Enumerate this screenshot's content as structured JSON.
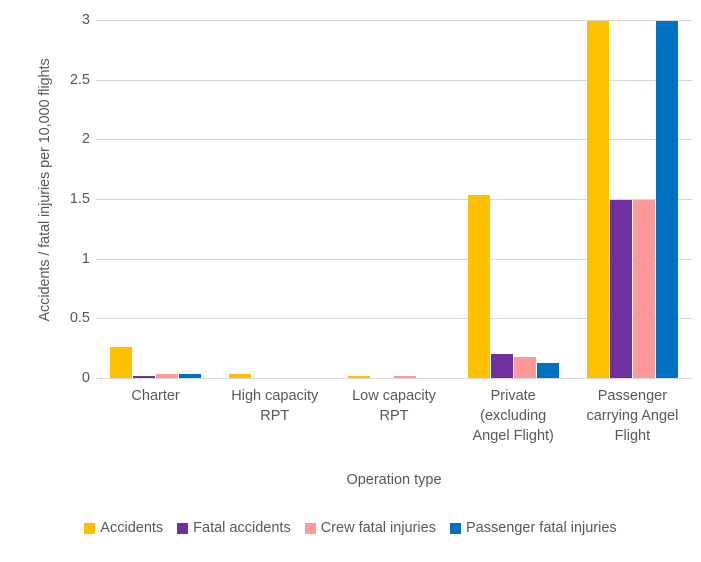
{
  "chart_data": {
    "type": "bar",
    "title": "",
    "xlabel": "Operation type",
    "ylabel": "Accidents / fatal injuries per 10,000 flights",
    "ylim": [
      0,
      3
    ],
    "yticks": [
      0,
      0.5,
      1,
      1.5,
      2,
      2.5,
      3
    ],
    "ytick_labels": [
      "0",
      "0.5",
      "1",
      "1.5",
      "2",
      "2.5",
      "3"
    ],
    "grid": true,
    "legend_position": "bottom",
    "categories": [
      "Charter",
      "High capacity RPT",
      "Low capacity RPT",
      "Private (excluding Angel Flight)",
      "Passenger carrying Angel Flight"
    ],
    "category_label_lines": [
      [
        "Charter"
      ],
      [
        "High capacity",
        "RPT"
      ],
      [
        "Low capacity",
        "RPT"
      ],
      [
        "Private",
        "(excluding",
        "Angel Flight)"
      ],
      [
        "Passenger",
        "carrying Angel",
        "Flight"
      ]
    ],
    "series": [
      {
        "name": "Accidents",
        "color": "#FFC000",
        "values": [
          0.26,
          0.03,
          0.02,
          1.53,
          2.99
        ]
      },
      {
        "name": "Fatal accidents",
        "color": "#7030A0",
        "values": [
          0.02,
          0,
          0,
          0.2,
          1.49
        ]
      },
      {
        "name": "Crew fatal injuries",
        "color": "#FF9999",
        "values": [
          0.03,
          0,
          0.01,
          0.18,
          1.49
        ]
      },
      {
        "name": "Passenger fatal injuries",
        "color": "#0070C0",
        "values": [
          0.03,
          0,
          0,
          0.13,
          2.99
        ]
      }
    ]
  },
  "colors": {
    "accidents": "#FFC000",
    "fatal_accidents": "#7030A0",
    "crew_fatal_injuries": "#FF9999",
    "passenger_fatal_injuries": "#0070C0",
    "gridline": "#D9D9D9",
    "text": "#595959",
    "background": "#FFFFFF"
  }
}
